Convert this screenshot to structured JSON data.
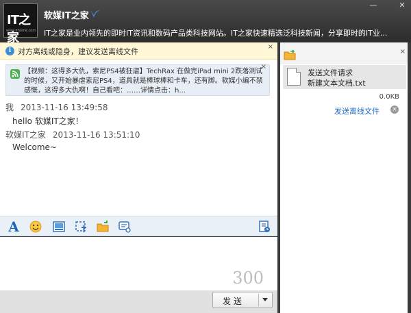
{
  "titlebar": {
    "avatar_logo": "IT之家",
    "avatar_sub": "www.ithome.com",
    "contact_name": "软媒IT之家",
    "signature": "IT之家是业内领先的即时IT资讯和数码产品类科技网站。IT之家快速精选泛科技新闻，分享即时的IT业...",
    "minimize": "—",
    "close": "✕"
  },
  "notice": {
    "text": "对方离线或隐身，建议发送离线文件",
    "close": "×"
  },
  "card": {
    "text": "【视频：这得多大仇，索尼PS4被狂虐】TechRax 在做完iPad mini 2跌落测试的时候，又开始暴虐索尼PS4，道具就是棒球棒和卡车，还有脚。软媒小编不禁感慨，这得多大仇啊！自己看吧：……详情点击：h...",
    "close": "×"
  },
  "messages": [
    {
      "sender": "我",
      "time": "2013-11-16 13:49:58",
      "text": "hello 软媒IT之家！"
    },
    {
      "sender": "软媒IT之家",
      "time": "2013-11-16 13:51:10",
      "text": "Welcome~"
    }
  ],
  "toolbar": {
    "font_glyph": "A"
  },
  "input": {
    "counter": "300"
  },
  "send": {
    "label": "发送"
  },
  "right_panel": {
    "close": "×",
    "file_request_title": "发送文件请求",
    "file_name": "新建文本文档.txt",
    "file_size": "0.0KB",
    "offline_send_link": "发送离线文件",
    "cancel_glyph": "×"
  },
  "colors": {
    "accent_blue": "#1f63b5",
    "link_blue": "#1f6cc5",
    "notice_bg": "#fff7d6",
    "titlebar_bg": "#3b3b3b"
  }
}
